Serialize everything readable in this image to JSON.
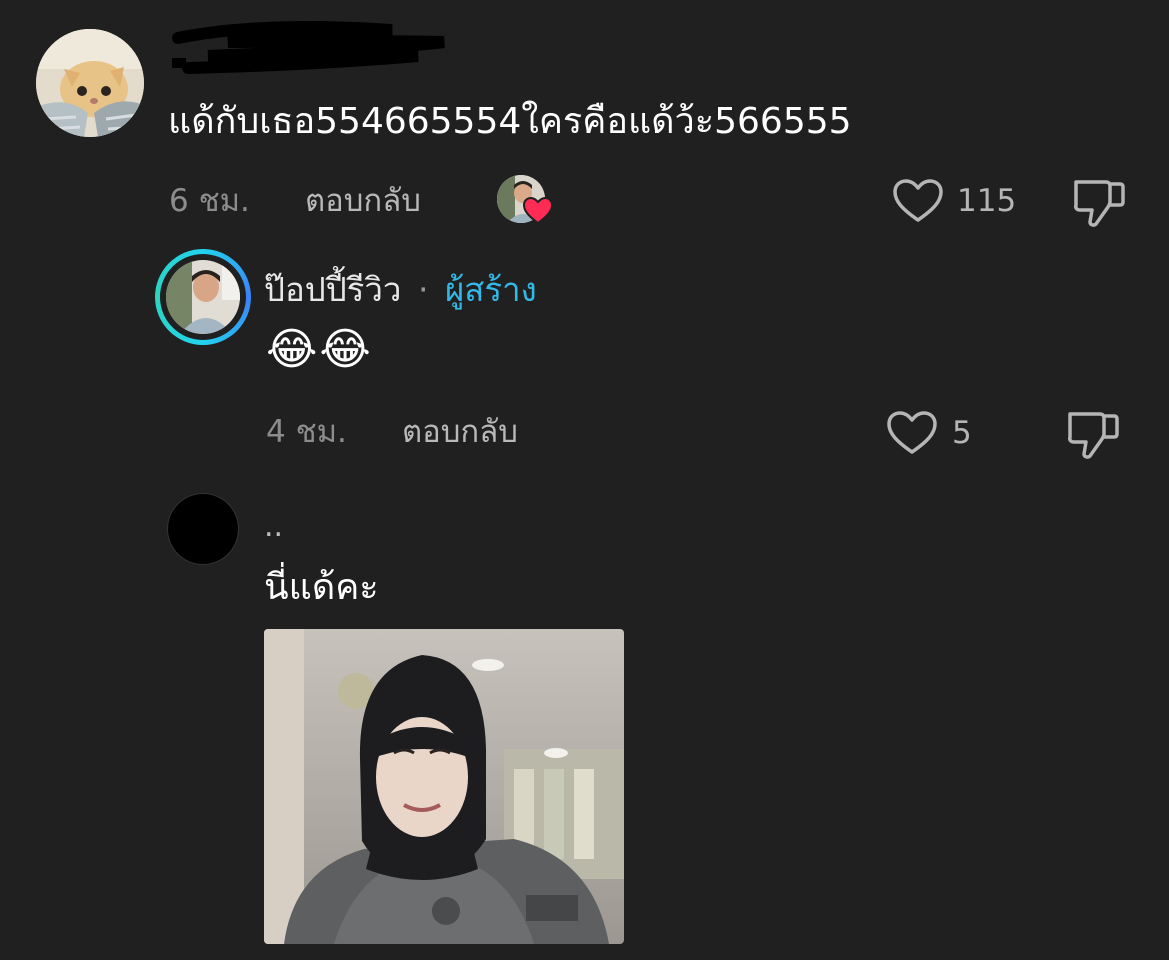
{
  "colors": {
    "background": "#202020",
    "creator_accent": "#33b8e8",
    "muted_text": "#8c8c8c",
    "heart_badge": "#fe2c55"
  },
  "comment": {
    "username": "",
    "text": "แด้กับเธอ554665554ใครคือแด้ว้ะ566555",
    "time": "6 ชม.",
    "reply_label": "ตอบกลับ",
    "likes": "115",
    "creator_liked": true,
    "icons": {
      "like": "heart-outline-icon",
      "dislike": "thumbs-down-icon",
      "creator_like_badge": "heart-filled-icon"
    }
  },
  "replies": [
    {
      "username": "ป๊อปปี้รีวิว",
      "separator": "·",
      "creator_tag": "ผู้สร้าง",
      "text": "😂😂",
      "time": "4 ชม.",
      "reply_label": "ตอบกลับ",
      "likes": "5"
    },
    {
      "username": "..",
      "text": "นี่แด้คะ"
    }
  ]
}
